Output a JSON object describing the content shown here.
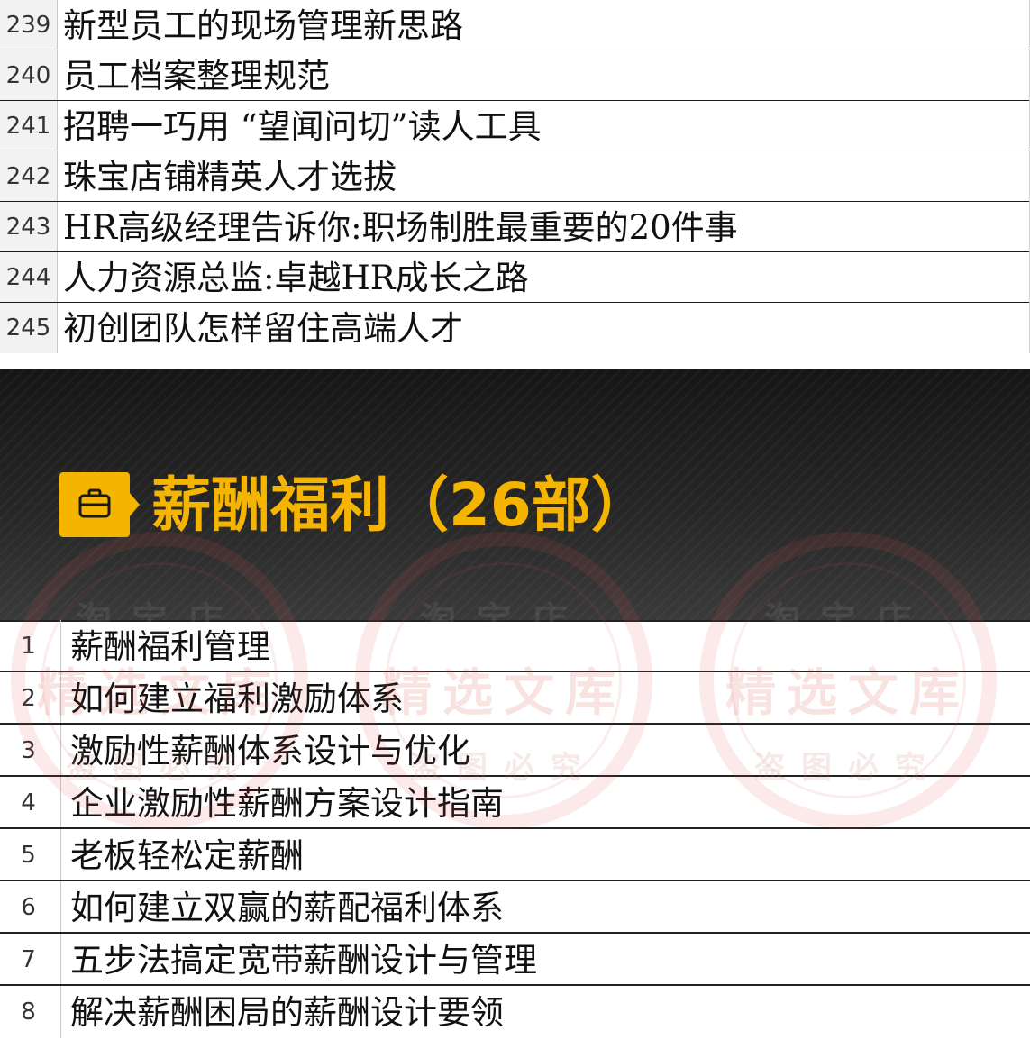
{
  "top_table": {
    "rows": [
      {
        "num": "239",
        "text": "新型员工的现场管理新思路"
      },
      {
        "num": "240",
        "text": "员工档案整理规范"
      },
      {
        "num": "241",
        "text": "招聘一巧用 “望闻问切”读人工具"
      },
      {
        "num": "242",
        "text": "珠宝店铺精英人才选拔"
      },
      {
        "num": "243",
        "text": "HR高级经理告诉你:职场制胜最重要的20件事"
      },
      {
        "num": "244",
        "text": "人力资源总监:卓越HR成长之路"
      },
      {
        "num": "245",
        "text": "初创团队怎样留住高端人才"
      }
    ]
  },
  "section": {
    "icon": "briefcase-icon",
    "title": "薪酬福利（26部）",
    "accent_color": "#f5b400"
  },
  "watermark": {
    "top": "淘宝店",
    "middle": "精选文库",
    "bottom": "盗图必究"
  },
  "bottom_table": {
    "rows": [
      {
        "num": "1",
        "text": "薪酬福利管理"
      },
      {
        "num": "2",
        "text": "如何建立福利激励体系"
      },
      {
        "num": "3",
        "text": "激励性薪酬体系设计与优化"
      },
      {
        "num": "4",
        "text": "企业激励性薪酬方案设计指南"
      },
      {
        "num": "5",
        "text": "老板轻松定薪酬"
      },
      {
        "num": "6",
        "text": "如何建立双赢的薪配福利体系"
      },
      {
        "num": "7",
        "text": "五步法搞定宽带薪酬设计与管理"
      },
      {
        "num": "8",
        "text": "解决薪酬困局的薪酬设计要领"
      }
    ]
  }
}
